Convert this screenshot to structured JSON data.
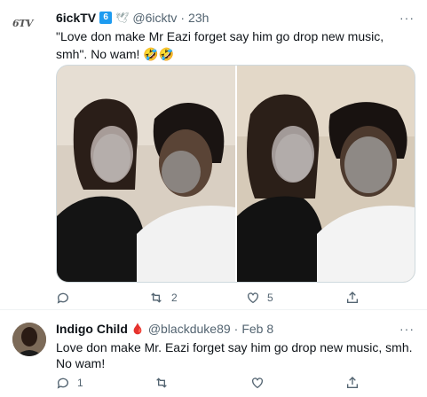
{
  "tweet1": {
    "display_name": "6ickTV",
    "badge": "6",
    "extra_emoji": "🕊",
    "handle": "@6icktv",
    "separator": "·",
    "time": "23h",
    "text": "\"Love don make Mr Eazi forget say him go drop new music, smh\". No wam! 🤣🤣",
    "more": "···",
    "replies": "",
    "retweets": "2",
    "likes": "5",
    "avatar_text": "6TV"
  },
  "tweet2": {
    "display_name": "Indigo Child",
    "extra_emoji": "🩸",
    "handle": "@blackduke89",
    "separator": "·",
    "time": "Feb 8",
    "text_line1": "Love don make Mr. Eazi forget say him go drop new music, smh.",
    "text_line2": "No wam!",
    "more": "···",
    "replies": "1",
    "retweets": "",
    "likes": ""
  },
  "colors": {
    "text": "#0f1419",
    "muted": "#536471",
    "verified_blue": "#1d9bf0",
    "border": "#cfd9de"
  },
  "icons": [
    "reply-icon",
    "retweet-icon",
    "like-icon",
    "share-icon"
  ]
}
